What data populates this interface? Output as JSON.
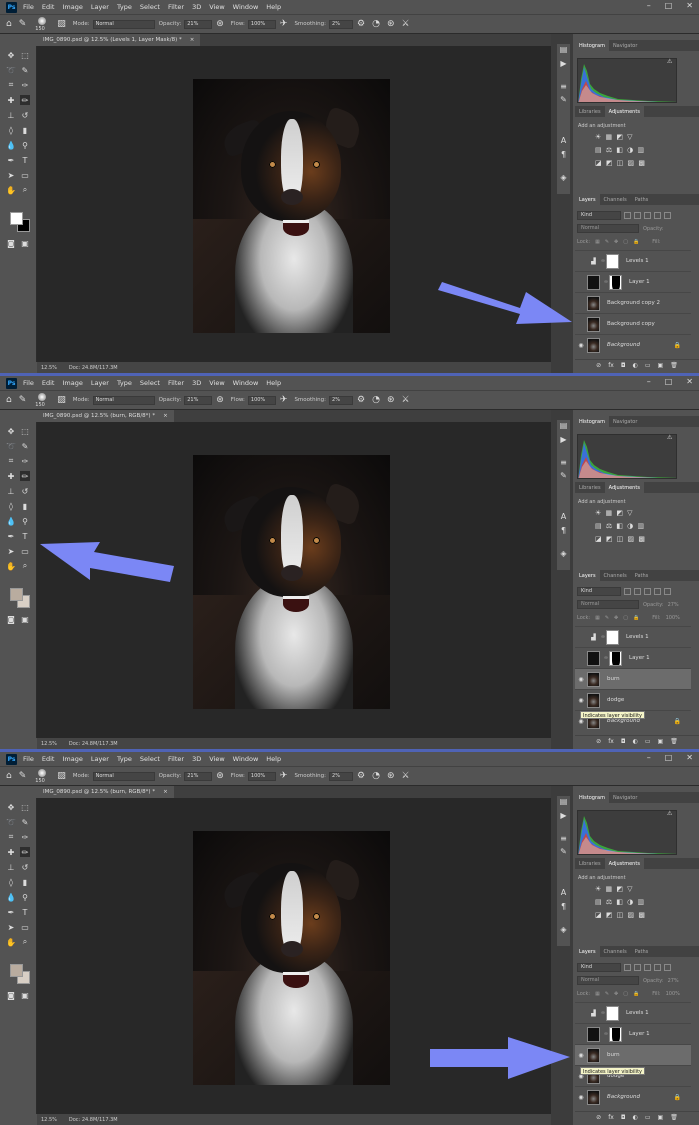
{
  "menu": [
    "File",
    "Edit",
    "Image",
    "Layer",
    "Type",
    "Select",
    "Filter",
    "3D",
    "View",
    "Window",
    "Help"
  ],
  "window_buttons": [
    "–",
    "□",
    "✕"
  ],
  "options": {
    "brush_size": "150",
    "mode_label": "Mode:",
    "mode_value": "Normal",
    "opacity_label": "Opacity:",
    "opacity_value": "21%",
    "flow_label": "Flow:",
    "flow_value": "100%",
    "smoothing_label": "Smoothing:",
    "smoothing_value": "2%"
  },
  "status": {
    "zoom": "12.5%",
    "doc": "Doc: 24.8M/117.3M"
  },
  "panels": {
    "top_tabs": [
      "Histogram",
      "Navigator"
    ],
    "mid_tabs": [
      "Libraries",
      "Adjustments"
    ],
    "adjust_note": "Add an adjustment",
    "adjust_icons_row1": "☀ ▦ ◩ ▽",
    "adjust_icons_row2": "▤ ⚖ ◧ ◑ ▥",
    "adjust_icons_row3": "◪ ◩ ◫ ▨ ▩",
    "layer_tabs": [
      "Layers",
      "Channels",
      "Paths"
    ],
    "kind": "Kind",
    "blend": "Normal",
    "opacity_label": "Opacity:",
    "fill_label": "Fill:",
    "lock_label": "Lock:",
    "footer_icons": [
      "⊘",
      "fx",
      "◘",
      "◐",
      "▭",
      "▣",
      "🗑"
    ]
  },
  "screens": [
    {
      "doc_tab": "IMG_0890.psd @ 12.5% (Levels 1, Layer Mask/8) *",
      "doc_close": "×",
      "opacity_val": "",
      "fill_val": "",
      "layers": [
        {
          "name": "Levels 1",
          "visible": false,
          "type": "adj",
          "italic": false
        },
        {
          "name": "Layer 1",
          "visible": false,
          "type": "mask",
          "italic": false
        },
        {
          "name": "Background copy 2",
          "visible": false,
          "type": "dog",
          "italic": false
        },
        {
          "name": "Background copy",
          "visible": false,
          "type": "dog",
          "italic": false
        },
        {
          "name": "Background",
          "visible": true,
          "type": "dog",
          "italic": true
        }
      ]
    },
    {
      "doc_tab": "IMG_0890.psd @ 12.5% (burn, RGB/8*) *",
      "doc_close": "×",
      "opacity_val": "27%",
      "fill_val": "100%",
      "tooltip": "Indicates layer visibility",
      "layers": [
        {
          "name": "Levels 1",
          "visible": false,
          "type": "adj",
          "italic": false
        },
        {
          "name": "Layer 1",
          "visible": false,
          "type": "mask",
          "italic": false
        },
        {
          "name": "burn",
          "visible": true,
          "type": "dog",
          "italic": false
        },
        {
          "name": "dodge",
          "visible": true,
          "type": "dog",
          "italic": false
        },
        {
          "name": "Background",
          "visible": true,
          "type": "dog",
          "italic": true
        }
      ]
    },
    {
      "doc_tab": "IMG_0890.psd @ 12.5% (burn, RGB/8*) *",
      "doc_close": "×",
      "opacity_val": "27%",
      "fill_val": "100%",
      "tooltip": "Indicates layer visibility",
      "layers": [
        {
          "name": "Levels 1",
          "visible": false,
          "type": "adj",
          "italic": false
        },
        {
          "name": "Layer 1",
          "visible": false,
          "type": "mask",
          "italic": false
        },
        {
          "name": "burn",
          "visible": true,
          "type": "dog",
          "italic": false
        },
        {
          "name": "dodge",
          "visible": true,
          "type": "dog",
          "italic": false
        },
        {
          "name": "Background",
          "visible": true,
          "type": "dog",
          "italic": true
        }
      ]
    }
  ],
  "colors": {
    "arrow": "#7b87f5",
    "separator": "#4f63b6",
    "fg_swatch_1": "#ffffff",
    "bg_swatch_1": "#000000",
    "fg_swatch_2": "#b9ac9f",
    "bg_swatch_2": "#d8cfc5"
  }
}
